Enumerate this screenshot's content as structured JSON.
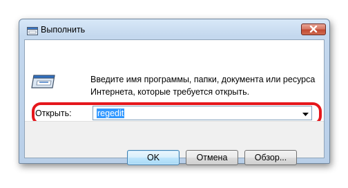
{
  "window": {
    "title": "Выполнить"
  },
  "dialog": {
    "description_line1": "Введите имя программы, папки, документа или ресурса",
    "description_line2": "Интернета, которые требуется открыть.",
    "open_label": "Открыть:",
    "open_value": "regedit"
  },
  "buttons": {
    "ok": "OK",
    "cancel": "Отмена",
    "browse": "Обзор..."
  },
  "colors": {
    "highlight_ring": "#e5171c",
    "selection": "#3399ff"
  },
  "icons": {
    "title": "run-icon",
    "close": "close-icon",
    "dropdown": "chevron-down-icon"
  }
}
